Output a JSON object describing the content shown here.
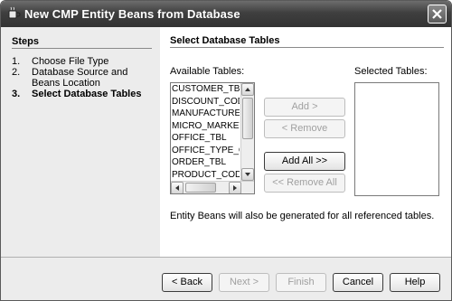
{
  "window": {
    "title": "New CMP Entity Beans from Database"
  },
  "steps": {
    "heading": "Steps",
    "items": [
      {
        "num": "1.",
        "label": "Choose File Type"
      },
      {
        "num": "2.",
        "label": "Database Source and Beans Location"
      },
      {
        "num": "3.",
        "label": "Select Database Tables"
      }
    ]
  },
  "main": {
    "heading": "Select Database Tables",
    "available_label": "Available Tables:",
    "selected_label": "Selected Tables:",
    "available_tables": [
      "CUSTOMER_TBL",
      "DISCOUNT_CODE_",
      "MANUFACTURE_T",
      "MICRO_MARKETS_",
      "OFFICE_TBL",
      "OFFICE_TYPE_CO",
      "ORDER_TBL",
      "PRODUCT_CODE_"
    ],
    "buttons": {
      "add": "Add >",
      "remove": "< Remove",
      "add_all": "Add All >>",
      "remove_all": "<< Remove All"
    },
    "note": "Entity Beans will also be generated for all referenced tables."
  },
  "footer": {
    "back": "< Back",
    "next": "Next >",
    "finish": "Finish",
    "cancel": "Cancel",
    "help": "Help"
  }
}
